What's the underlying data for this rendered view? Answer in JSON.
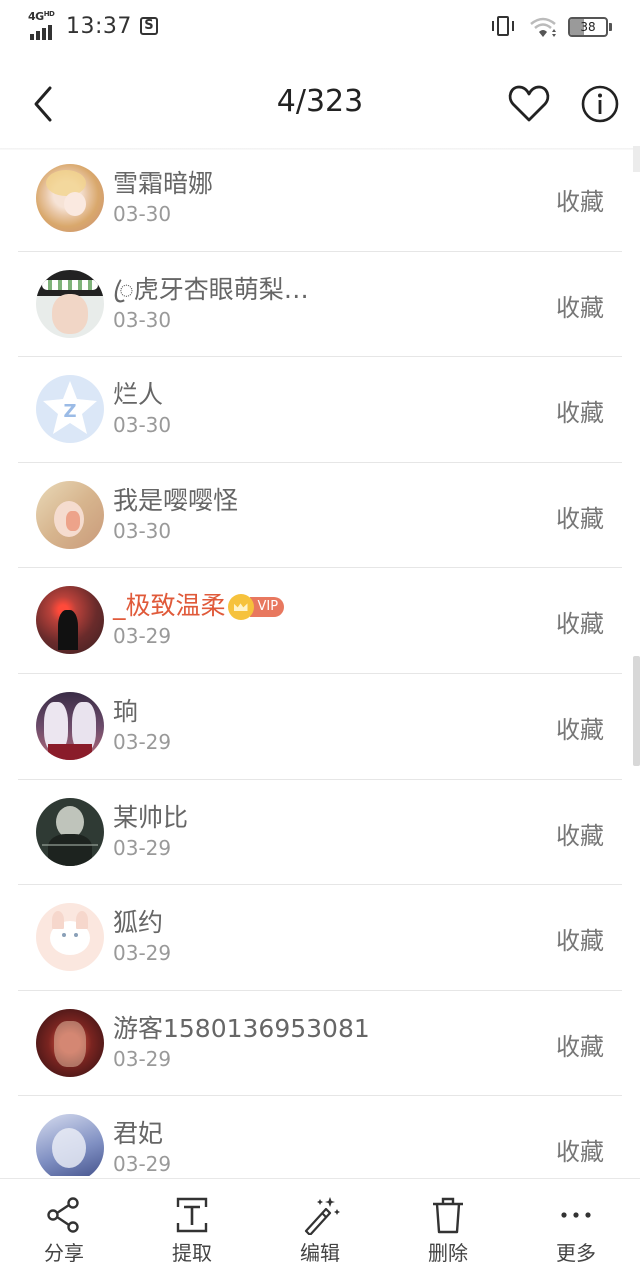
{
  "status_bar": {
    "network": "4G",
    "network_sup": "HD",
    "time": "13:37",
    "battery": "38",
    "battery_level": 0.38
  },
  "header": {
    "title": "4/323",
    "back_icon": "chevron-left-icon",
    "favorite_icon": "heart-icon",
    "info_icon": "info-icon"
  },
  "list": {
    "action_label": "收藏",
    "items": [
      {
        "name": "雪霜暗娜",
        "date": "03-30",
        "vip": false
      },
      {
        "name": "ꦿ虎牙杏眼萌梨…",
        "date": "03-30",
        "vip": false
      },
      {
        "name": "烂人",
        "date": "03-30",
        "vip": false
      },
      {
        "name": "我是嘤嘤怪",
        "date": "03-30",
        "vip": false
      },
      {
        "name": "_极致温柔",
        "date": "03-29",
        "vip": true,
        "vip_label": "VIP"
      },
      {
        "name": "珦",
        "date": "03-29",
        "vip": false
      },
      {
        "name": "某帅比",
        "date": "03-29",
        "vip": false
      },
      {
        "name": "狐约",
        "date": "03-29",
        "vip": false
      },
      {
        "name": "游客1580136953081",
        "date": "03-29",
        "vip": false
      },
      {
        "name": "君妃",
        "date": "03-29",
        "vip": false
      }
    ]
  },
  "toolbar": {
    "items": [
      {
        "label": "分享",
        "icon": "share-icon"
      },
      {
        "label": "提取",
        "icon": "extract-text-icon"
      },
      {
        "label": "编辑",
        "icon": "magic-wand-icon"
      },
      {
        "label": "删除",
        "icon": "trash-icon"
      },
      {
        "label": "更多",
        "icon": "more-icon"
      }
    ]
  },
  "colors": {
    "vip_name": "#e05a3a",
    "vip_badge": "#e8785f",
    "crown": "#f6c23c",
    "text": "#666666",
    "date": "#999999"
  }
}
